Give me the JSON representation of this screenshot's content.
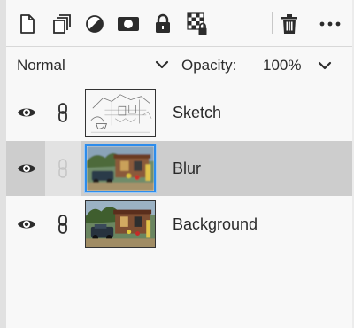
{
  "toolbar": {
    "icons": [
      "new-layer-icon",
      "duplicate-layer-icon",
      "adjustment-layer-icon",
      "mask-icon",
      "lock-icon",
      "transparency-lock-icon",
      "trash-icon",
      "more-icon"
    ]
  },
  "blend": {
    "mode": "Normal",
    "opacity_label": "Opacity:",
    "opacity_value": "100%"
  },
  "layers": [
    {
      "name": "Sketch",
      "visible": true,
      "linked": true,
      "selected": false,
      "thumbnail": "pencil-sketch"
    },
    {
      "name": "Blur",
      "visible": true,
      "linked": false,
      "selected": true,
      "thumbnail": "blurred-photo"
    },
    {
      "name": "Background",
      "visible": true,
      "linked": true,
      "selected": false,
      "thumbnail": "photo"
    }
  ],
  "colors": {
    "panel_bg": "#f8f8f8",
    "selected_row": "#cdcdcd",
    "accent_border": "#2d8ceb",
    "text": "#2c2c2c"
  }
}
